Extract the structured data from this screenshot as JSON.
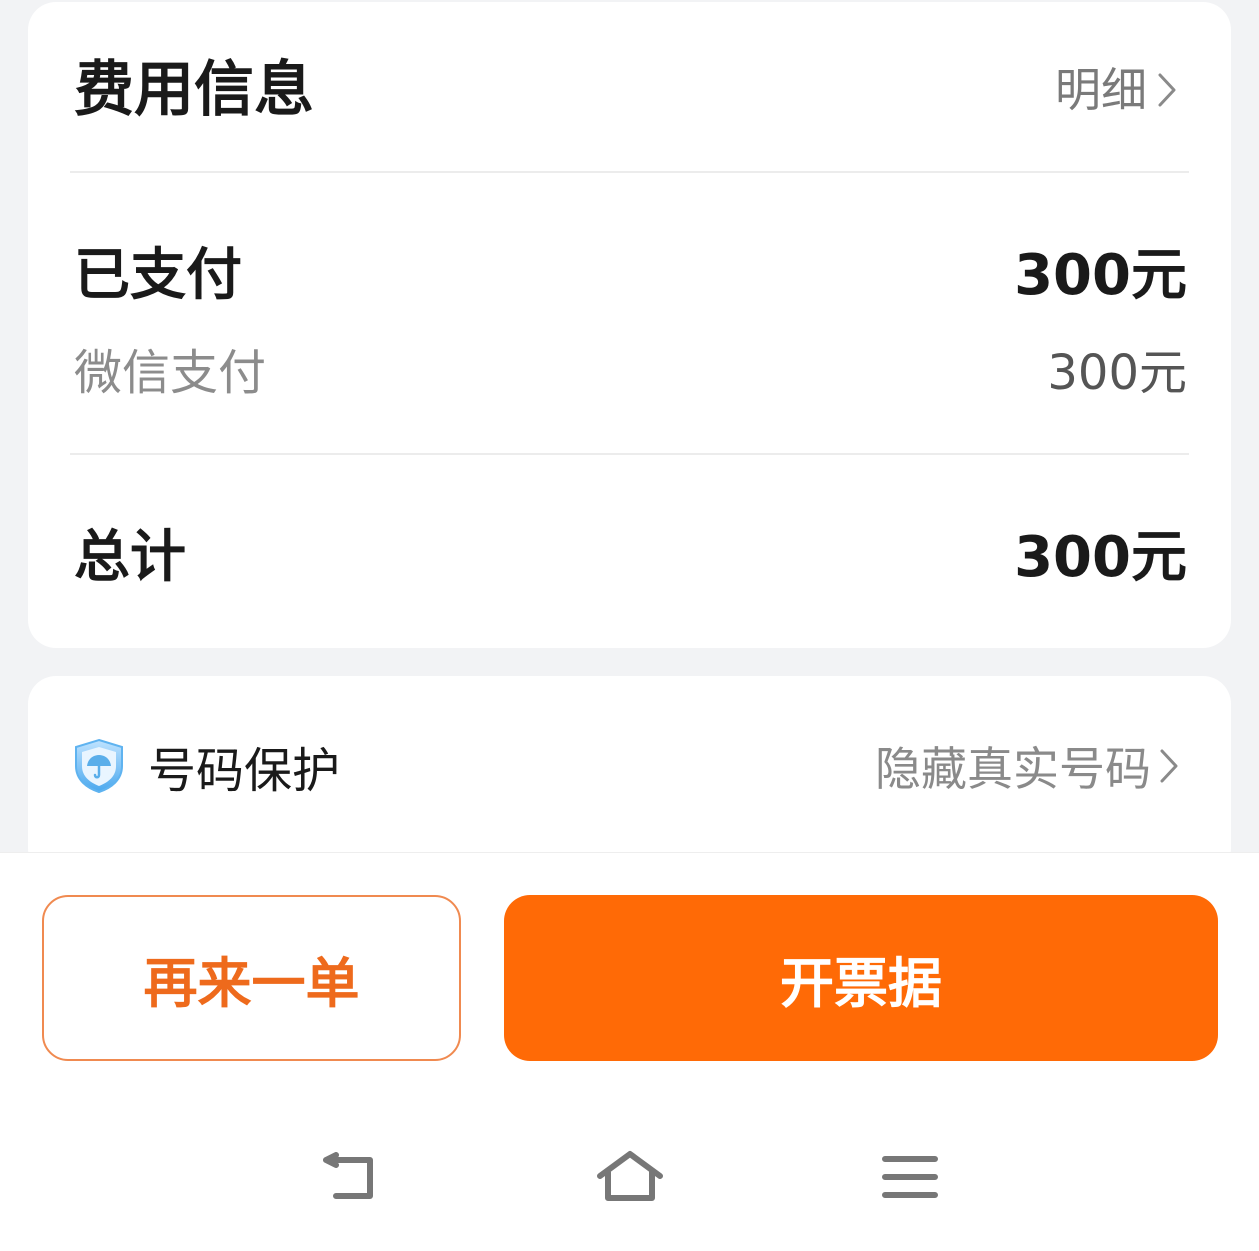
{
  "fee": {
    "title": "费用信息",
    "detail_link": "明细",
    "paid_label": "已支付",
    "paid_amount": "300元",
    "wechat_label": "微信支付",
    "wechat_amount": "300元",
    "total_label": "总计",
    "total_amount": "300元"
  },
  "privacy": {
    "label": "号码保护",
    "value": "隐藏真实号码"
  },
  "actions": {
    "reorder": "再来一单",
    "invoice": "开票据"
  },
  "colors": {
    "accent": "#ff6a06",
    "reorder_text": "#ee6a1c",
    "shield": "#4aa8ee"
  },
  "icons": {
    "detail_chevron": "chevron-right-icon",
    "privacy_shield": "shield-umbrella-icon",
    "privacy_chevron": "chevron-right-icon",
    "nav_back": "back-icon",
    "nav_home": "home-icon",
    "nav_menu": "menu-icon"
  }
}
